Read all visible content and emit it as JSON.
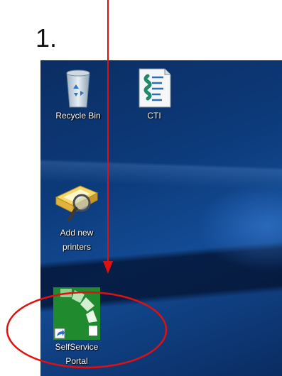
{
  "step": {
    "number": "1."
  },
  "desktop": {
    "icons": [
      {
        "label": "Recycle Bin",
        "icon": "recycle-bin-icon"
      },
      {
        "label": "CTI",
        "icon": "script-file-icon"
      },
      {
        "label": "Add new printers",
        "label_line1": "Add new",
        "label_line2": "printers",
        "icon": "printer-magnifier-icon"
      },
      {
        "label": "SelfService Portal",
        "label_line1": "SelfService",
        "label_line2": "Portal",
        "icon": "selfservice-portal-icon",
        "shortcut_badge": "shortcut-arrow-icon"
      }
    ]
  },
  "annotations": {
    "arrow_color": "#e01010",
    "circle_color": "#e01010"
  },
  "colors": {
    "desktop_dark": "#0b2e63",
    "desktop_mid": "#134b94",
    "portal_green": "#1f8a2e"
  }
}
